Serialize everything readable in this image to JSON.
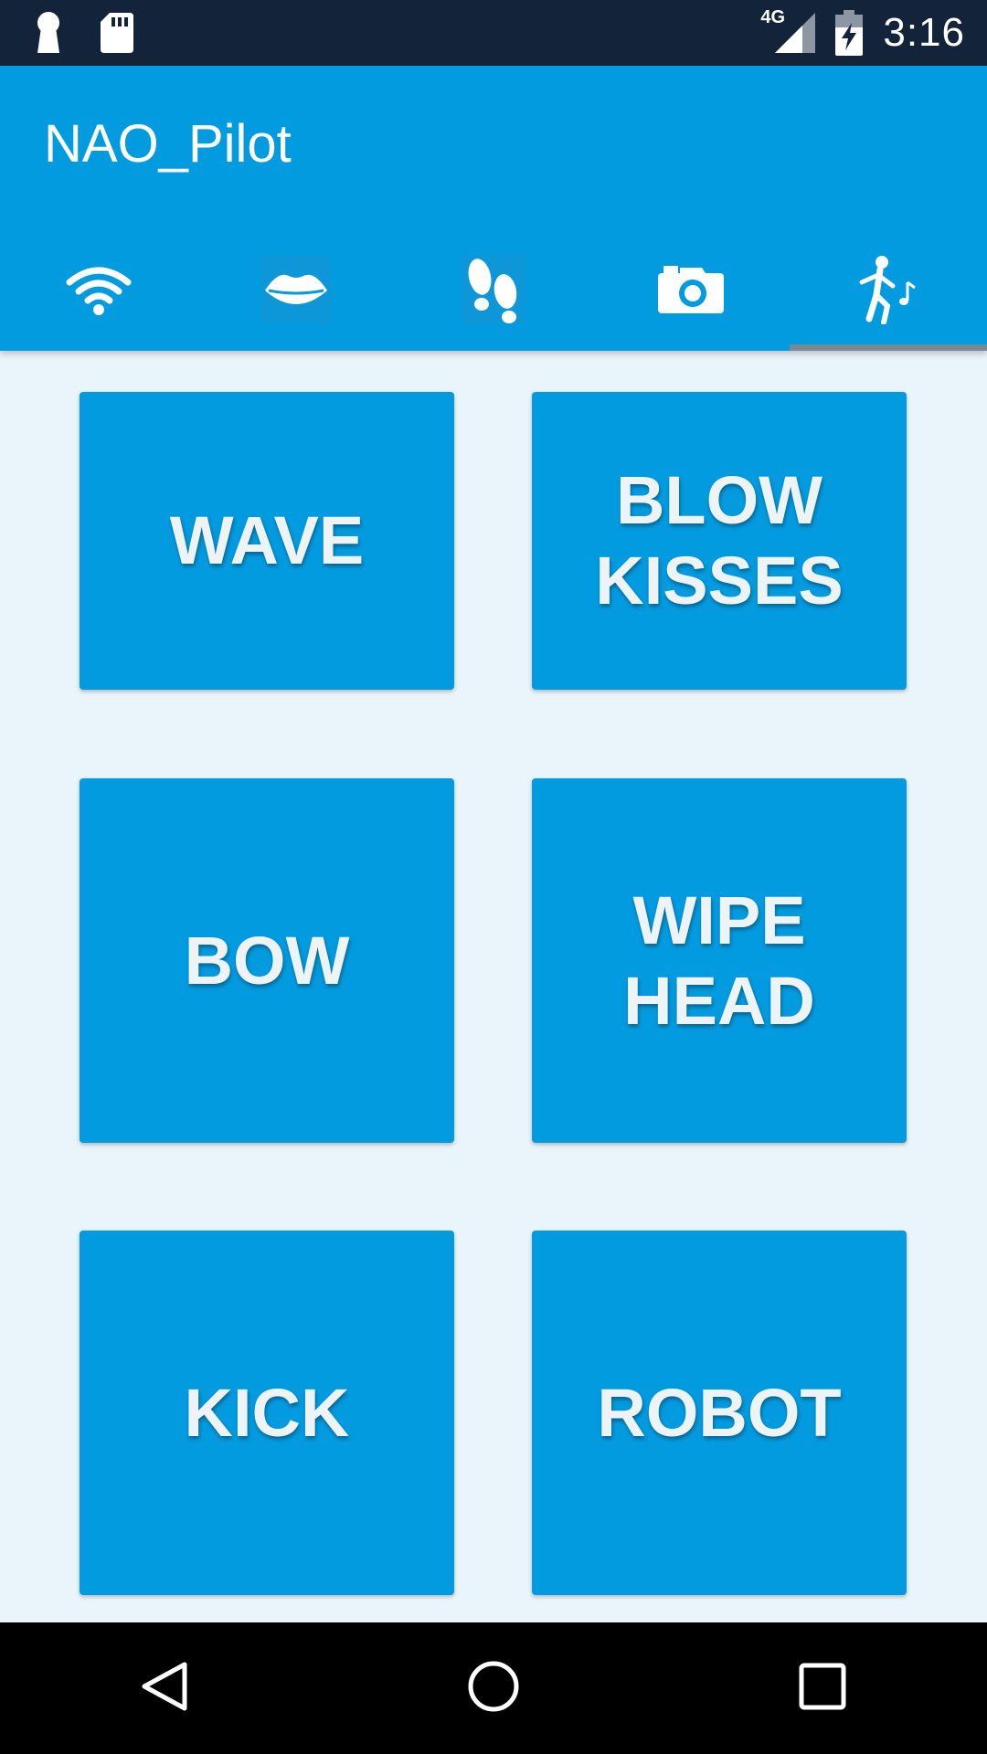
{
  "status_bar": {
    "network": "4G",
    "time": "3:16",
    "left_icons": [
      "keyhole-icon",
      "sd-card-icon"
    ],
    "right_icons": [
      "signal-icon",
      "battery-charging-icon"
    ]
  },
  "app_bar": {
    "title": "NAO_Pilot",
    "background": "#039BE0",
    "tabs": [
      {
        "icon": "wifi-icon",
        "selected": false
      },
      {
        "icon": "lips-icon",
        "selected": false
      },
      {
        "icon": "footprints-icon",
        "selected": false
      },
      {
        "icon": "camera-icon",
        "selected": false
      },
      {
        "icon": "dancing-person-icon",
        "selected": true
      }
    ]
  },
  "actions": [
    {
      "label": "WAVE"
    },
    {
      "label": "BLOW\nKISSES"
    },
    {
      "label": "BOW"
    },
    {
      "label": "WIPE\nHEAD"
    },
    {
      "label": "KICK"
    },
    {
      "label": "ROBOT"
    }
  ],
  "nav_bar": {
    "icons": [
      "back-icon",
      "home-icon",
      "recents-icon"
    ]
  },
  "colors": {
    "accent": "#039BE0",
    "status_bar": "#13233A",
    "content_background": "#EAF4FB",
    "tab_indicator": "#7A8A93"
  }
}
